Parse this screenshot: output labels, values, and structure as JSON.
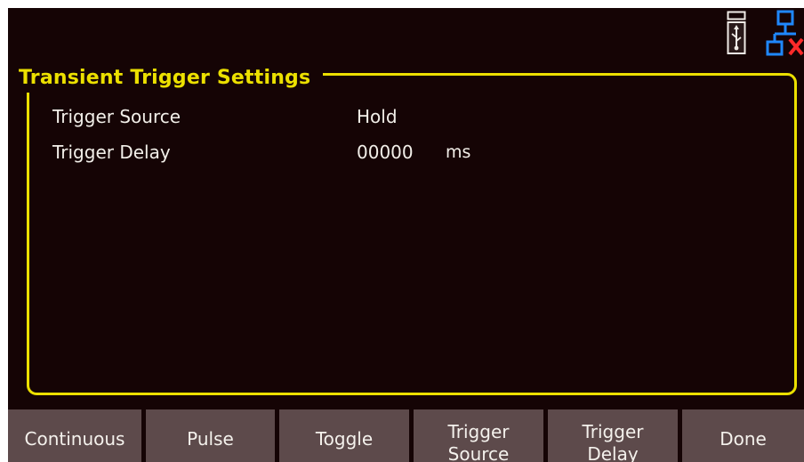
{
  "status_bar": {
    "usb_icon": "usb-storage-icon",
    "network_icon": "network-disconnected-icon",
    "colors": {
      "usb": "#f0ebe6",
      "network": "#1f88ff",
      "network_error": "#ff2a2a"
    }
  },
  "panel": {
    "title": "Transient Trigger Settings",
    "border_color": "#ece000",
    "rows": [
      {
        "label": "Trigger Source",
        "value": "Hold",
        "unit": ""
      },
      {
        "label": "Trigger Delay",
        "value": "00000",
        "unit": "ms"
      }
    ]
  },
  "softkeys": {
    "continuous": "Continuous",
    "pulse": "Pulse",
    "toggle": "Toggle",
    "trigger_source": {
      "line1": "Trigger",
      "line2": "Source"
    },
    "trigger_delay": {
      "line1": "Trigger",
      "line2": "Delay"
    },
    "done": "Done"
  },
  "colors": {
    "background": "#150405",
    "softkey_bg": "#5d4a4b",
    "text": "#f2efe9",
    "accent": "#ece000"
  }
}
